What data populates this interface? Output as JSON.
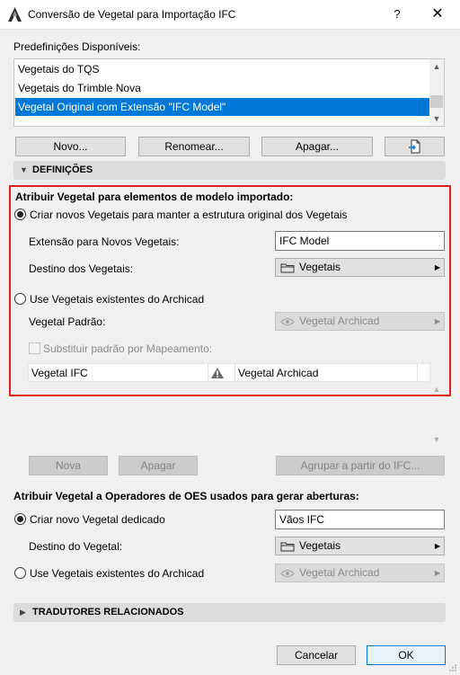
{
  "window": {
    "title": "Conversão de Vegetal para Importação IFC",
    "help": "?",
    "close": "✕"
  },
  "presets": {
    "label": "Predefinições Disponíveis:",
    "items": [
      {
        "label": "Vegetais do TQS",
        "selected": false
      },
      {
        "label": "Vegetais do Trimble Nova",
        "selected": false
      },
      {
        "label": "Vegetal Original com Extensão \"IFC Model\"",
        "selected": true
      }
    ],
    "buttons": {
      "new": "Novo...",
      "rename": "Renomear...",
      "delete": "Apagar...",
      "import_icon": "import-file-icon"
    }
  },
  "definitions": {
    "header": "DEFINIÇÕES",
    "group_title": "Atribuir Vegetal para elementos de modelo importado:",
    "create_new": {
      "label": "Criar novos Vegetais para manter a estrutura original dos Vegetais",
      "checked": true,
      "extension_label": "Extensão para Novos Vegetais:",
      "extension_value": "IFC Model",
      "destination_label": "Destino dos Vegetais:",
      "destination_value": "Vegetais"
    },
    "use_existing": {
      "label": "Use Vegetais existentes do Archicad",
      "checked": false,
      "default_label": "Vegetal Padrão:",
      "default_value": "Vegetal Archicad",
      "replace_label": "Substituir padrão por Mapeamento:"
    },
    "table": {
      "col_ifc": "Vegetal IFC",
      "col_archicad": "Vegetal Archicad"
    },
    "buttons": {
      "new": "Nova",
      "delete": "Apagar",
      "group": "Agrupar a partir do IFC..."
    }
  },
  "oes": {
    "title": "Atribuir Vegetal a Operadores de OES usados para gerar aberturas:",
    "create_new": {
      "label": "Criar novo Vegetal dedicado",
      "checked": true,
      "value": "Vãos IFC"
    },
    "destination_label": "Destino do Vegetal:",
    "destination_value": "Vegetais",
    "use_existing": {
      "label": "Use Vegetais existentes do Archicad",
      "checked": false,
      "value": "Vegetal Archicad"
    }
  },
  "translators": {
    "header": "TRADUTORES RELACIONADOS"
  },
  "footer": {
    "cancel": "Cancelar",
    "ok": "OK"
  },
  "colors": {
    "selection": "#0078d7",
    "highlight": "#e02020",
    "primary_border": "#0078d7"
  }
}
